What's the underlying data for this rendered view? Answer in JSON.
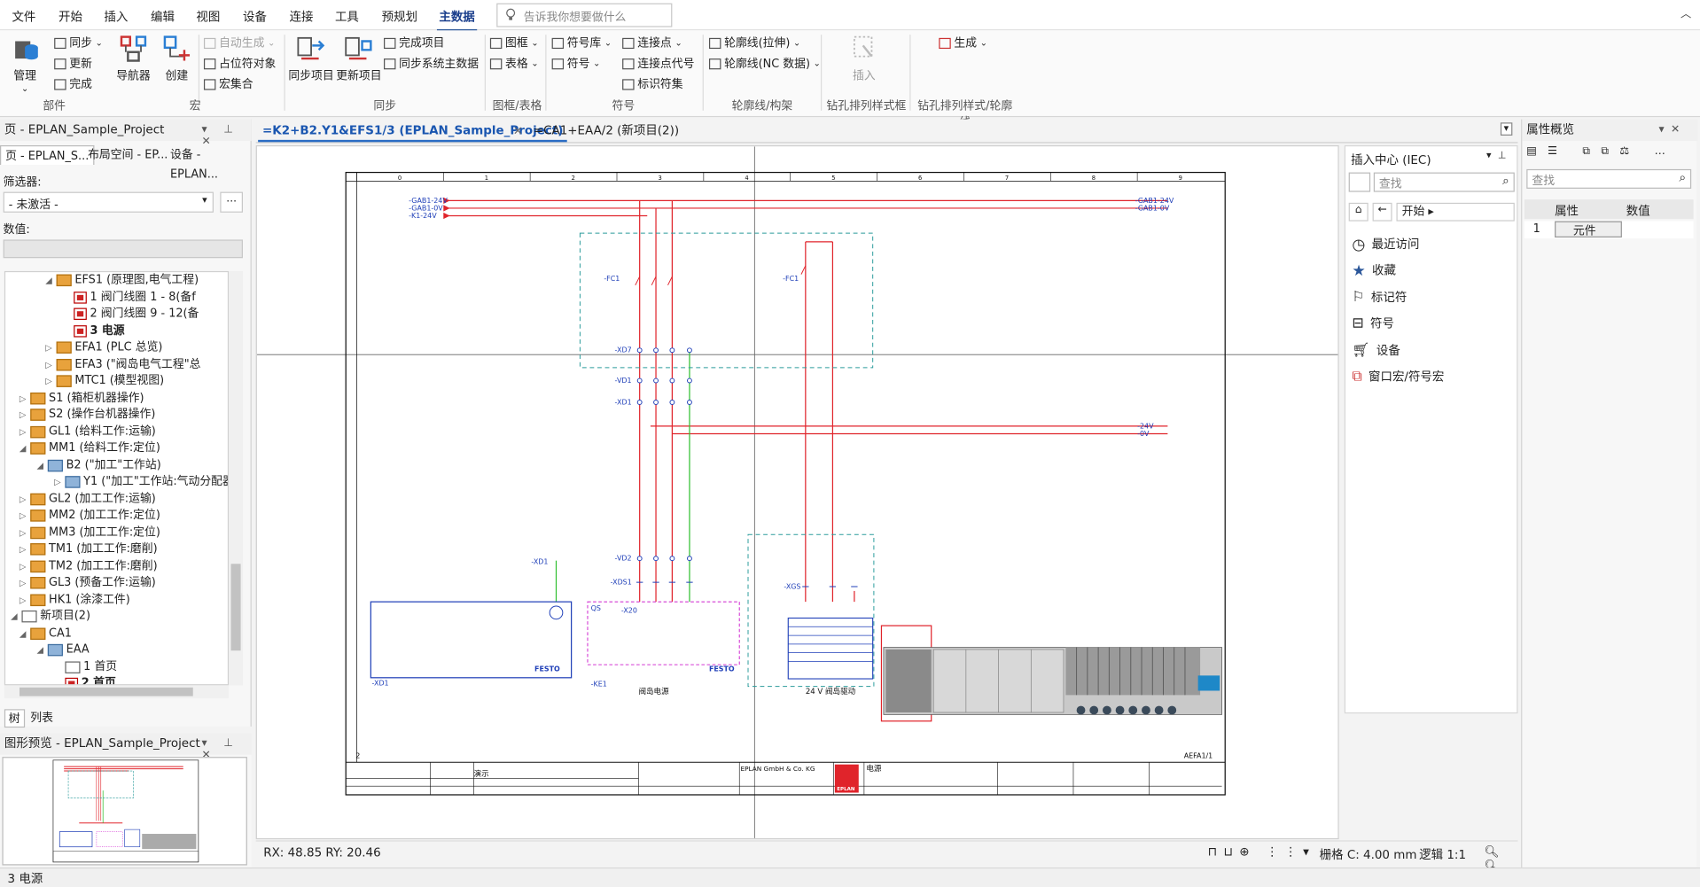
{
  "menu": {
    "items": [
      "文件",
      "开始",
      "插入",
      "编辑",
      "视图",
      "设备",
      "连接",
      "工具",
      "预规划",
      "主数据"
    ],
    "active": "主数据",
    "tellme_placeholder": "告诉我你想要做什么"
  },
  "ribbon": {
    "parts": {
      "manage": "管理",
      "sync": "同步",
      "update": "更新",
      "complete": "完成",
      "navigator": "导航器",
      "create": "创建",
      "label": "部件"
    },
    "macro": {
      "auto_generate": "自动生成",
      "placeholder_obj": "占位符对象",
      "macro_set": "宏集合",
      "label": "宏"
    },
    "sync": {
      "sync_project": "同步项目",
      "update_project": "更新项目",
      "complete_project": "完成项目",
      "sync_system": "同步系统主数据",
      "label": "同步"
    },
    "frames": {
      "frame": "图框",
      "table": "表格",
      "label": "图框/表格"
    },
    "symbols": {
      "symlib": "符号库",
      "symbol": "符号",
      "label": "符号"
    },
    "connect": {
      "point": "连接点",
      "point_code": "连接点代号",
      "marker": "标识符集"
    },
    "outline": {
      "stretch": "轮廓线(拉伸)",
      "nc": "轮廓线(NC 数据)",
      "label": "轮廓线/构架"
    },
    "drill": {
      "insert": "插入",
      "label": "钻孔排列样式框"
    },
    "gen": {
      "generate": "生成",
      "label": "钻孔排列样式/轮廓线"
    }
  },
  "left_panel": {
    "title": "页 - EPLAN_Sample_Project",
    "tabs": [
      "页 - EPLAN_S...",
      "布局空间 - EP...",
      "设备 - EPLAN..."
    ],
    "filter_label": "筛选器:",
    "filter_value": "- 未激活 -",
    "filter_btn": "...",
    "value_label": "数值:",
    "bottom_tabs": [
      "树",
      "列表"
    ],
    "tree": [
      {
        "label": "EFS1 (原理图,电气工程)",
        "indent": 4,
        "icon": "ws",
        "exp": "◢"
      },
      {
        "label": "1 阀门线圈 1 - 8(备f",
        "indent": 6,
        "icon": "pg",
        "exp": ""
      },
      {
        "label": "2 阀门线圈 9 - 12(备",
        "indent": 6,
        "icon": "pg",
        "exp": ""
      },
      {
        "label": "3 电源",
        "indent": 6,
        "icon": "pg",
        "exp": "",
        "bold": true
      },
      {
        "label": "EFA1 (PLC 总览)",
        "indent": 4,
        "icon": "ws",
        "exp": "▷"
      },
      {
        "label": "EFA3 (\"阀岛电气工程\"总",
        "indent": 4,
        "icon": "ws",
        "exp": "▷"
      },
      {
        "label": "MTC1 (模型视图)",
        "indent": 4,
        "icon": "ws",
        "exp": "▷"
      },
      {
        "label": "S1 (箱柜机器操作)",
        "indent": 1,
        "icon": "ws",
        "exp": "▷"
      },
      {
        "label": "S2 (操作台机器操作)",
        "indent": 1,
        "icon": "ws",
        "exp": "▷"
      },
      {
        "label": "GL1 (给料工作:运输)",
        "indent": 1,
        "icon": "ws",
        "exp": "▷"
      },
      {
        "label": "MM1 (给料工作:定位)",
        "indent": 1,
        "icon": "ws",
        "exp": "◢"
      },
      {
        "label": "B2 (\"加工\"工作站)",
        "indent": 3,
        "icon": "wsb",
        "exp": "◢"
      },
      {
        "label": "Y1 (\"加工\"工作站:气动分配器",
        "indent": 5,
        "icon": "wsb",
        "exp": "▷"
      },
      {
        "label": "GL2 (加工工作:运输)",
        "indent": 1,
        "icon": "ws",
        "exp": "▷"
      },
      {
        "label": "MM2 (加工工作:定位)",
        "indent": 1,
        "icon": "ws",
        "exp": "▷"
      },
      {
        "label": "MM3 (加工工作:定位)",
        "indent": 1,
        "icon": "ws",
        "exp": "▷"
      },
      {
        "label": "TM1 (加工工作:磨削)",
        "indent": 1,
        "icon": "ws",
        "exp": "▷"
      },
      {
        "label": "TM2 (加工工作:磨削)",
        "indent": 1,
        "icon": "ws",
        "exp": "▷"
      },
      {
        "label": "GL3 (预备工作:运输)",
        "indent": 1,
        "icon": "ws",
        "exp": "▷"
      },
      {
        "label": "HK1 (涂漆工件)",
        "indent": 1,
        "icon": "ws",
        "exp": "▷"
      },
      {
        "label": "新项目(2)",
        "indent": 0,
        "icon": "pr",
        "exp": "◢"
      },
      {
        "label": "CA1",
        "indent": 1,
        "icon": "ws",
        "exp": "◢"
      },
      {
        "label": "EAA",
        "indent": 3,
        "icon": "wsb",
        "exp": "◢"
      },
      {
        "label": "1 首页",
        "indent": 5,
        "icon": "pgb",
        "exp": ""
      },
      {
        "label": "2 首页",
        "indent": 5,
        "icon": "pg",
        "exp": "",
        "bold": true
      }
    ],
    "preview_title": "图形预览 - EPLAN_Sample_Project"
  },
  "doc": {
    "tabs": [
      "=K2+B2.Y1&EFS1/3 (EPLAN_Sample_Project)",
      "=CA1+EAA/2 (新项目(2))"
    ],
    "close": "×",
    "coords": "RX: 48.85 RY: 20.46",
    "grid": "栅格 C: 4.00 mm",
    "logic": "逻辑 1:1"
  },
  "schematic": {
    "ruler": [
      "0",
      "1",
      "2",
      "3",
      "4",
      "5",
      "6",
      "7",
      "8",
      "9"
    ],
    "nets_left": [
      "-GAB1-24V",
      "-GAB1-0V",
      "-K1-24V"
    ],
    "nets_right": [
      "-GAB1-24V",
      "-GAB1-0V"
    ],
    "nets_mid": [
      "-24V",
      "-0V"
    ],
    "labels": {
      "pc1a": "-FC1",
      "pc1b": "-FC1",
      "xd7": "-XD7",
      "vd1": "-VD1",
      "xd1": "-XD1",
      "xd1b": "-XD1",
      "vd2": "-VD2",
      "xds1": "-XDS1",
      "x20": "-X20",
      "ke1": "-KE1",
      "xgs": "-XGS",
      "qs": "QS",
      "festo": "FESTO",
      "festo2": "FESTO",
      "left_cap": "-XD1",
      "valve_supply": "阀岛电源",
      "valve_drive": "24 V 阀岛驱动",
      "page_num": "2",
      "sheet": "AEFA1/1",
      "company": "EPLAN GmbH & Co. KG",
      "title_cn": "电源",
      "demo": "演示",
      "eplan": "EPLAN"
    }
  },
  "insert_center": {
    "title": "插入中心 (IEC)",
    "search_placeholder": "查找",
    "crumb": "开始",
    "items": [
      "最近访问",
      "收藏",
      "标记符",
      "符号",
      "设备",
      "窗口宏/符号宏"
    ]
  },
  "properties": {
    "title": "属性概览",
    "search_placeholder": "查找",
    "col_prop": "属性",
    "col_val": "数值",
    "row_num": "1",
    "row_val": "元件"
  },
  "statusbar": {
    "text": "3 电源"
  },
  "colors": {
    "accent": "#2b579a",
    "red_wire": "#e0242b",
    "green_wire": "#2fbf2f",
    "cyan_box": "#2a9b9b",
    "magenta_box": "#d43ad4",
    "blue_comp": "#1f3fb8"
  }
}
